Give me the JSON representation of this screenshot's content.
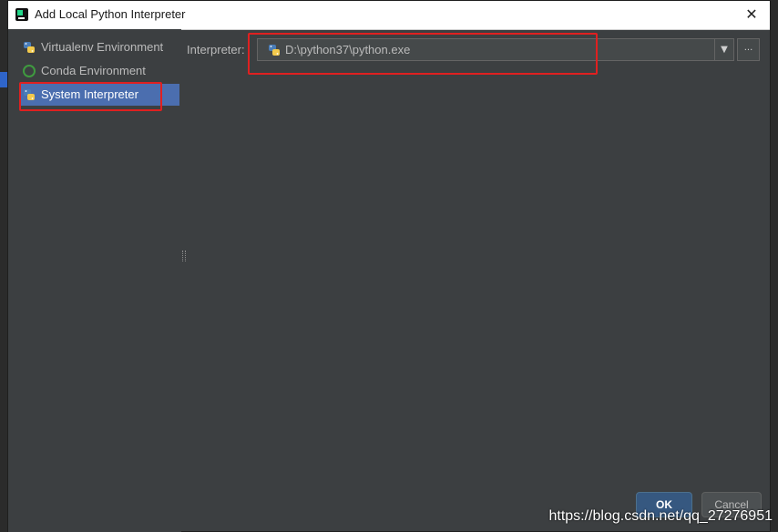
{
  "dialog": {
    "title": "Add Local Python Interpreter",
    "close_label": "✕"
  },
  "sidebar": {
    "items": [
      {
        "label": "Virtualenv Environment",
        "icon": "python-icon",
        "selected": false
      },
      {
        "label": "Conda Environment",
        "icon": "conda-icon",
        "selected": false
      },
      {
        "label": "System Interpreter",
        "icon": "python-icon",
        "selected": true
      }
    ]
  },
  "form": {
    "interpreter_label": "Interpreter:",
    "interpreter_value": "D:\\python37\\python.exe",
    "browse_label": "..."
  },
  "buttons": {
    "ok_label": "OK",
    "cancel_label": "Cancel"
  },
  "watermark": "https://blog.csdn.net/qq_27276951",
  "colors": {
    "dialog_bg": "#3c3f41",
    "selection": "#4b6eaf",
    "highlight_box": "#e02020",
    "ok_button": "#365880"
  }
}
